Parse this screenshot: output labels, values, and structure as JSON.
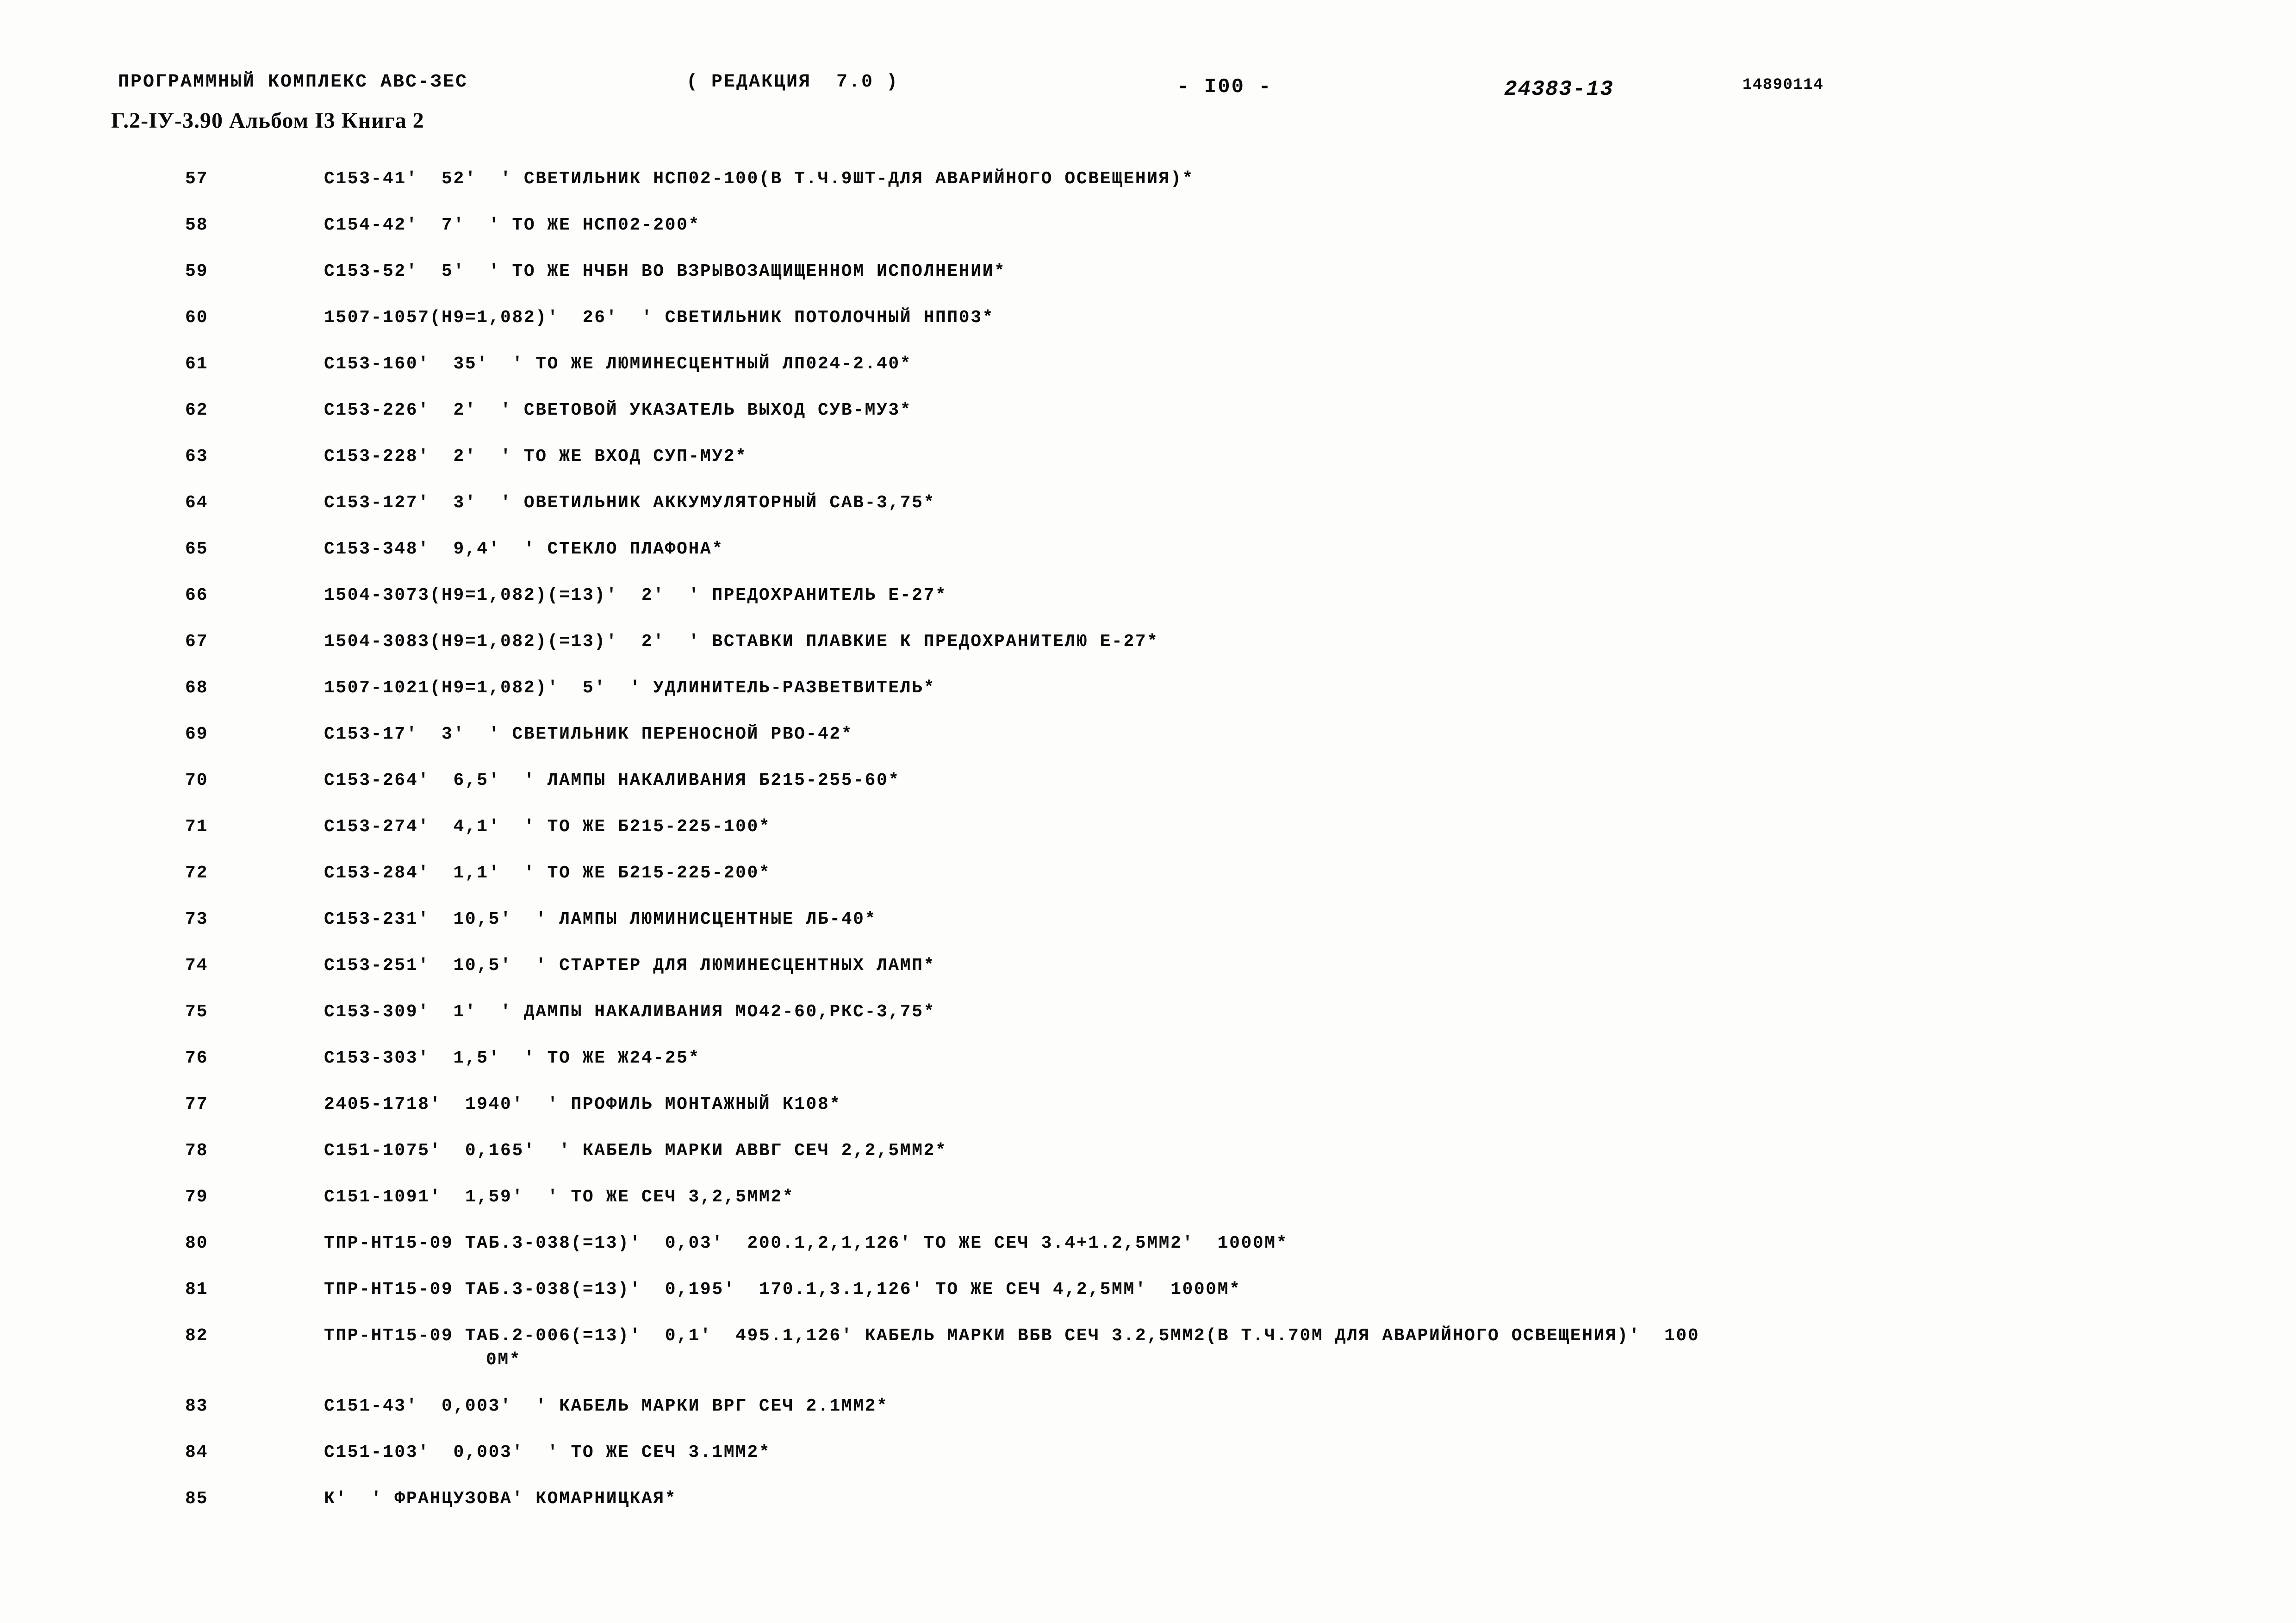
{
  "header": {
    "program_title": "ПРОГРАММНЫЙ КОМПЛЕКС АВС-ЗЕС",
    "edition": "( РЕДАКЦИЯ  7.0 )",
    "page_number": "- I00 -",
    "doc_number": "24383-13",
    "serial_number": "14890114",
    "album_line": "Г.2-IУ-3.90 Альбом I3 Книга 2"
  },
  "listing": {
    "rows": [
      {
        "num": "57",
        "text": "С153-41′  52′  ′ СВЕТИЛЬНИК НСП02-100(В Т.Ч.9ШТ-ДЛЯ АВАРИЙНОГО ОСВЕЩЕНИЯ)*"
      },
      {
        "num": "58",
        "text": "С154-42′  7′  ′ ТО ЖЕ НСП02-200*"
      },
      {
        "num": "59",
        "text": "С153-52′  5′  ′ ТО ЖЕ НЧБН ВО ВЗРЫВОЗАЩИЩЕННОМ ИСПОЛНЕНИИ*"
      },
      {
        "num": "60",
        "text": "1507-1057(Н9=1,082)′  26′  ′ СВЕТИЛЬНИК ПОТОЛОЧНЫЙ НПП03*"
      },
      {
        "num": "61",
        "text": "С153-160′  35′  ′ ТО ЖЕ ЛЮМИНЕСЦЕНТНЫЙ ЛП024-2.40*"
      },
      {
        "num": "62",
        "text": "С153-226′  2′  ′ СВЕТОВОЙ УКАЗАТЕЛЬ ВЫХОД СУВ-МУ3*"
      },
      {
        "num": "63",
        "text": "С153-228′  2′  ′ ТО ЖЕ ВХОД СУП-МУ2*"
      },
      {
        "num": "64",
        "text": "С153-127′  3′  ′ ОВЕТИЛЬНИК АККУМУЛЯТОРНЫЙ САВ-3,75*"
      },
      {
        "num": "65",
        "text": "С153-348′  9,4′  ′ СТЕКЛО ПЛАФОНА*"
      },
      {
        "num": "66",
        "text": "1504-3073(Н9=1,082)(=13)′  2′  ′ ПРЕДОХРАНИТЕЛЬ Е-27*"
      },
      {
        "num": "67",
        "text": "1504-3083(Н9=1,082)(=13)′  2′  ′ ВСТАВКИ ПЛАВКИЕ К ПРЕДОХРАНИТЕЛЮ Е-27*"
      },
      {
        "num": "68",
        "text": "1507-1021(Н9=1,082)′  5′  ′ УДЛИНИТЕЛЬ-РАЗВЕТВИТЕЛЬ*"
      },
      {
        "num": "69",
        "text": "С153-17′  3′  ′ СВЕТИЛЬНИК ПЕРЕНОСНОЙ РВО-42*"
      },
      {
        "num": "70",
        "text": "С153-264′  6,5′  ′ ЛАМПЫ НАКАЛИВАНИЯ Б215-255-60*"
      },
      {
        "num": "71",
        "text": "С153-274′  4,1′  ′ ТО ЖЕ Б215-225-100*"
      },
      {
        "num": "72",
        "text": "С153-284′  1,1′  ′ ТО ЖЕ Б215-225-200*"
      },
      {
        "num": "73",
        "text": "С153-231′  10,5′  ′ ЛАМПЫ ЛЮМИНИСЦЕНТНЫЕ ЛБ-40*"
      },
      {
        "num": "74",
        "text": "С153-251′  10,5′  ′ СТАРТЕР ДЛЯ ЛЮМИНЕСЦЕНТНЫХ ЛАМП*"
      },
      {
        "num": "75",
        "text": "С153-309′  1′  ′ ДАМПЫ НАКАЛИВАНИЯ МО42-60,РКС-3,75*"
      },
      {
        "num": "76",
        "text": "С153-303′  1,5′  ′ ТО ЖЕ Ж24-25*"
      },
      {
        "num": "77",
        "text": "2405-1718′  1940′  ′ ПРОФИЛЬ МОНТАЖНЫЙ К108*"
      },
      {
        "num": "78",
        "text": "С151-1075′  0,165′  ′ КАБЕЛЬ МАРКИ АВВГ СЕЧ 2,2,5ММ2*"
      },
      {
        "num": "79",
        "text": "С151-1091′  1,59′  ′ ТО ЖЕ СЕЧ 3,2,5ММ2*"
      },
      {
        "num": "80",
        "text": "ТПР-НТ15-09 ТАБ.3-038(=13)′  0,03′  200.1,2,1,126′ ТО ЖЕ СЕЧ 3.4+1.2,5ММ2′  1000М*"
      },
      {
        "num": "81",
        "text": "ТПР-НТ15-09 ТАБ.3-038(=13)′  0,195′  170.1,3.1,126′ ТО ЖЕ СЕЧ 4,2,5ММ′  1000М*"
      },
      {
        "num": "82",
        "text": "ТПР-НТ15-09 ТАБ.2-006(=13)′  0,1′  495.1,126′ КАБЕЛЬ МАРКИ ВБВ СЕЧ 3.2,5ММ2(В Т.Ч.70М ДЛЯ АВАРИЙНОГО ОСВЕЩЕНИЯ)′  100",
        "cont": "0М*"
      },
      {
        "num": "83",
        "text": "С151-43′  0,003′  ′ КАБЕЛЬ МАРКИ ВРГ СЕЧ 2.1ММ2*"
      },
      {
        "num": "84",
        "text": "С151-103′  0,003′  ′ ТО ЖЕ СЕЧ 3.1ММ2*"
      },
      {
        "num": "85",
        "text": "К′  ′ ФРАНЦУЗОВА′ КОМАРНИЦКАЯ*"
      }
    ]
  }
}
